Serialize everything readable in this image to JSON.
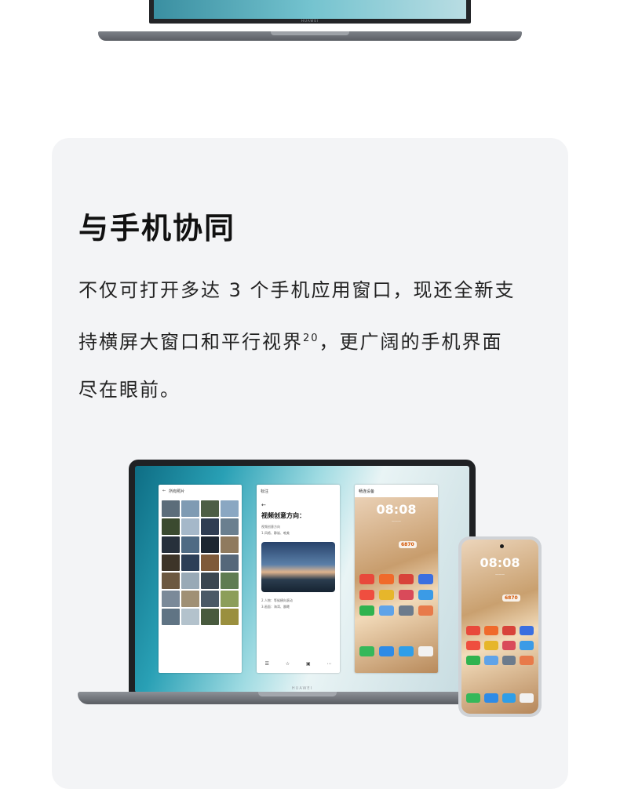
{
  "top_laptop": {
    "brand": "HUAWEI"
  },
  "section": {
    "title": "与手机协同",
    "desc_line1": "不仅可打开多达 3 个手机应用窗口，现还全新支",
    "desc_line2_pre": "持横屏大窗口和平行视界",
    "desc_line2_sup": "20",
    "desc_line2_post": "，更广阔的手机界面",
    "desc_line3": "尽在眼前。"
  },
  "laptop": {
    "brand": "HUAWEI",
    "gallery_window": {
      "title": "所有照片"
    },
    "editor_window": {
      "top_label": "标注",
      "doc_title": "视频创意方向：",
      "line1": "视频创意方向",
      "line2": "1.风格、静谧、唯美",
      "line3": "2.人物：等候横向滚动",
      "line4": "3.画面：海湾、晨曦"
    },
    "phone_window": {
      "title": "畅连设备",
      "clock": "08:08",
      "weather": "6870"
    }
  },
  "phone": {
    "clock": "08:08",
    "weather": "6870"
  },
  "colors": {
    "card_bg": "#f3f4f6",
    "title": "#111111",
    "body_text": "#222222"
  }
}
